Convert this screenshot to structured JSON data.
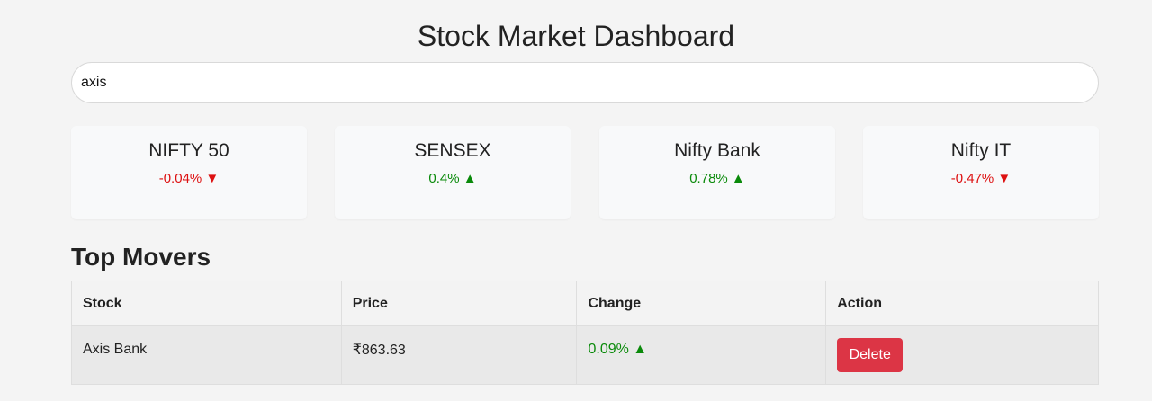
{
  "header": {
    "title": "Stock Market Dashboard"
  },
  "search": {
    "value": "axis",
    "placeholder": ""
  },
  "indices": [
    {
      "name": "NIFTY 50",
      "change": "-0.04% ▼",
      "direction": "down"
    },
    {
      "name": "SENSEX",
      "change": "0.4% ▲",
      "direction": "up"
    },
    {
      "name": "Nifty Bank",
      "change": "0.78% ▲",
      "direction": "up"
    },
    {
      "name": "Nifty IT",
      "change": "-0.47% ▼",
      "direction": "down"
    }
  ],
  "movers": {
    "title": "Top Movers",
    "columns": [
      "Stock",
      "Price",
      "Change",
      "Action"
    ],
    "rows": [
      {
        "stock": "Axis Bank",
        "price": "₹863.63",
        "change": "0.09% ▲",
        "action": "Delete"
      }
    ]
  },
  "colors": {
    "up": "#0a8a0a",
    "down": "#dd1111",
    "delete": "#dc3545"
  }
}
